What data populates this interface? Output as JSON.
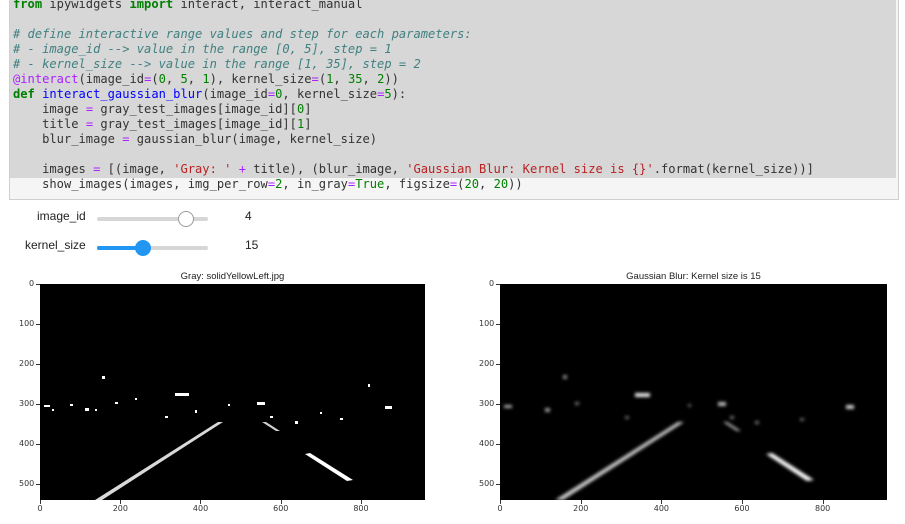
{
  "code_lines": [
    [
      {
        "t": "kw",
        "v": "from"
      },
      {
        "t": "",
        "v": " ipywidgets "
      },
      {
        "t": "kw",
        "v": "import"
      },
      {
        "t": "",
        "v": " interact, interact_manual"
      }
    ],
    [],
    [
      {
        "t": "cm",
        "v": "# define interactive range values and step for each parameters:"
      }
    ],
    [
      {
        "t": "cm",
        "v": "# - image_id --> value in the range [0, 5], step = 1"
      }
    ],
    [
      {
        "t": "cm",
        "v": "# - kernel_size --> value in the range [1, 35], step = 2"
      }
    ],
    [
      {
        "t": "dc",
        "v": "@interact"
      },
      {
        "t": "",
        "v": "(image_id"
      },
      {
        "t": "op",
        "v": "="
      },
      {
        "t": "",
        "v": "("
      },
      {
        "t": "num",
        "v": "0"
      },
      {
        "t": "",
        "v": ", "
      },
      {
        "t": "num",
        "v": "5"
      },
      {
        "t": "",
        "v": ", "
      },
      {
        "t": "num",
        "v": "1"
      },
      {
        "t": "",
        "v": "), kernel_size"
      },
      {
        "t": "op",
        "v": "="
      },
      {
        "t": "",
        "v": "("
      },
      {
        "t": "num",
        "v": "1"
      },
      {
        "t": "",
        "v": ", "
      },
      {
        "t": "num",
        "v": "35"
      },
      {
        "t": "",
        "v": ", "
      },
      {
        "t": "num",
        "v": "2"
      },
      {
        "t": "",
        "v": "))"
      }
    ],
    [
      {
        "t": "kw",
        "v": "def"
      },
      {
        "t": "",
        "v": " "
      },
      {
        "t": "fn",
        "v": "interact_gaussian_blur"
      },
      {
        "t": "",
        "v": "(image_id"
      },
      {
        "t": "op",
        "v": "="
      },
      {
        "t": "num",
        "v": "0"
      },
      {
        "t": "",
        "v": ", kernel_size"
      },
      {
        "t": "op",
        "v": "="
      },
      {
        "t": "num",
        "v": "5"
      },
      {
        "t": "",
        "v": "):"
      }
    ],
    [
      {
        "t": "",
        "v": "    image "
      },
      {
        "t": "op",
        "v": "="
      },
      {
        "t": "",
        "v": " gray_test_images[image_id]["
      },
      {
        "t": "num",
        "v": "0"
      },
      {
        "t": "",
        "v": "]"
      }
    ],
    [
      {
        "t": "",
        "v": "    title "
      },
      {
        "t": "op",
        "v": "="
      },
      {
        "t": "",
        "v": " gray_test_images[image_id]["
      },
      {
        "t": "num",
        "v": "1"
      },
      {
        "t": "",
        "v": "]"
      }
    ],
    [
      {
        "t": "",
        "v": "    blur_image "
      },
      {
        "t": "op",
        "v": "="
      },
      {
        "t": "",
        "v": " gaussian_blur(image, kernel_size)"
      }
    ],
    [],
    [
      {
        "t": "",
        "v": "    images "
      },
      {
        "t": "op",
        "v": "="
      },
      {
        "t": "",
        "v": " [(image, "
      },
      {
        "t": "st",
        "v": "'Gray: '"
      },
      {
        "t": "",
        "v": " "
      },
      {
        "t": "op",
        "v": "+"
      },
      {
        "t": "",
        "v": " title), (blur_image, "
      },
      {
        "t": "st",
        "v": "'Gaussian Blur: Kernel size is {}'"
      },
      {
        "t": "",
        "v": ".format(kernel_size))]"
      }
    ],
    [
      {
        "t": "",
        "v": "    show_images(images, img_per_row"
      },
      {
        "t": "op",
        "v": "="
      },
      {
        "t": "num",
        "v": "2"
      },
      {
        "t": "",
        "v": ", in_gray"
      },
      {
        "t": "op",
        "v": "="
      },
      {
        "t": "bi",
        "v": "True"
      },
      {
        "t": "",
        "v": ", figsize"
      },
      {
        "t": "op",
        "v": "="
      },
      {
        "t": "",
        "v": "("
      },
      {
        "t": "num",
        "v": "20"
      },
      {
        "t": "",
        "v": ", "
      },
      {
        "t": "num",
        "v": "20"
      },
      {
        "t": "",
        "v": "))"
      }
    ]
  ],
  "widgets": {
    "image_id": {
      "label": "image_id",
      "value": "4",
      "min": 0,
      "max": 5,
      "fraction": 0.8
    },
    "kernel_size": {
      "label": "kernel_size",
      "value": "15",
      "min": 1,
      "max": 35,
      "fraction": 0.41
    }
  },
  "plots": {
    "left_title": "Gray: solidYellowLeft.jpg",
    "right_title": "Gaussian Blur: Kernel size is 15",
    "y_ticks": [
      "0",
      "100",
      "200",
      "300",
      "400",
      "500"
    ],
    "x_ticks": [
      "0",
      "200",
      "400",
      "600",
      "800"
    ]
  },
  "colors": {
    "slider_accent": "#2196f3",
    "handle_blue": "#2196f3",
    "handle_white": "#ffffff"
  }
}
